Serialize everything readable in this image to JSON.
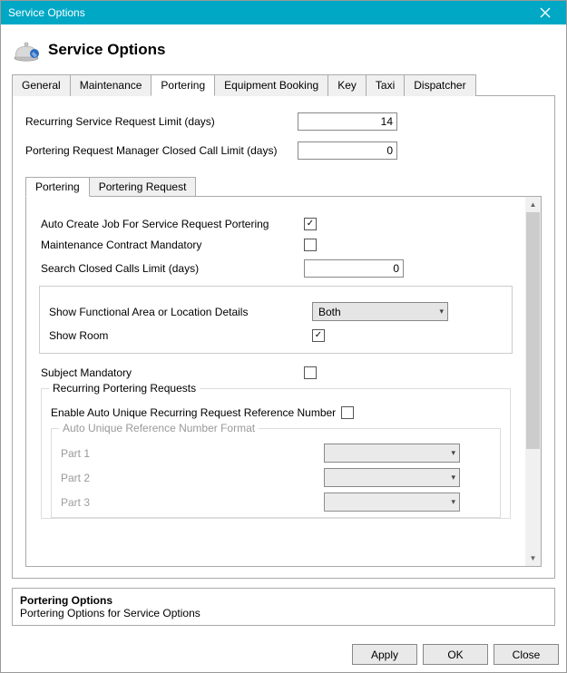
{
  "window": {
    "title": "Service Options"
  },
  "header": {
    "title": "Service Options"
  },
  "tabs": {
    "general": "General",
    "maintenance": "Maintenance",
    "portering": "Portering",
    "equipment_booking": "Equipment Booking",
    "key": "Key",
    "taxi": "Taxi",
    "dispatcher": "Dispatcher"
  },
  "portering": {
    "recurring_limit_label": "Recurring Service Request Limit (days)",
    "recurring_limit_value": "14",
    "closed_call_limit_label": "Portering Request Manager Closed Call Limit (days)",
    "closed_call_limit_value": "0",
    "inner_tabs": {
      "portering": "Portering",
      "portering_request": "Portering Request"
    },
    "opts": {
      "auto_create_job": {
        "label": "Auto Create Job For Service Request Portering",
        "checked": true
      },
      "maint_contract_mandatory": {
        "label": "Maintenance Contract Mandatory",
        "checked": false
      },
      "search_closed_calls": {
        "label": "Search Closed Calls Limit (days)",
        "value": "0"
      },
      "show_func_area": {
        "label": "Show Functional Area or Location Details",
        "value": "Both"
      },
      "show_room": {
        "label": "Show Room",
        "checked": true
      },
      "subject_mandatory": {
        "label": "Subject Mandatory",
        "checked": false
      }
    },
    "recurring_group": {
      "legend": "Recurring Portering Requests",
      "enable_unique": {
        "label": "Enable Auto Unique Recurring Request Reference Number",
        "checked": false
      },
      "format_group": {
        "legend": "Auto Unique Reference Number Format",
        "parts": {
          "p1": "Part 1",
          "p2": "Part 2",
          "p3": "Part 3"
        }
      }
    }
  },
  "description": {
    "title": "Portering Options",
    "text": "Portering Options for Service Options"
  },
  "buttons": {
    "apply": "Apply",
    "ok": "OK",
    "close": "Close"
  }
}
